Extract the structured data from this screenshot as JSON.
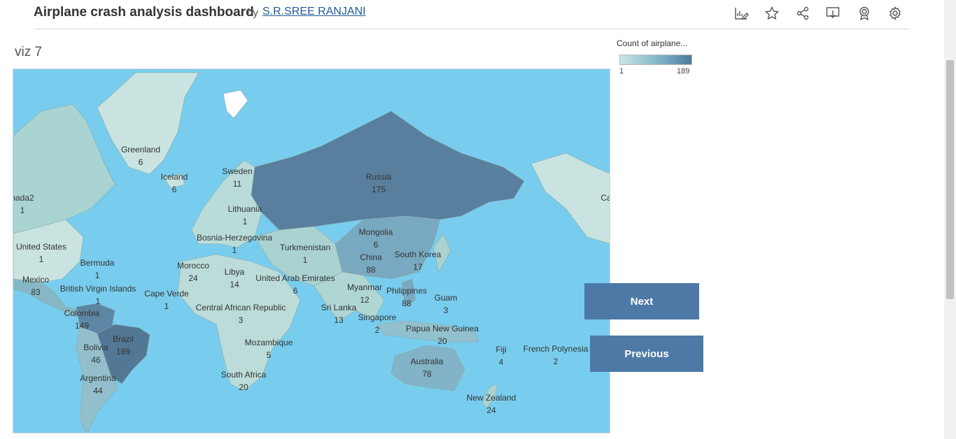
{
  "header": {
    "title": "Airplane crash analysis dashboard",
    "by": "by",
    "author": "S.R.SREE RANJANI",
    "icons": [
      "edit-chart-icon",
      "star-icon",
      "share-icon",
      "download-icon",
      "award-icon",
      "settings-icon"
    ]
  },
  "viz": {
    "title": "viz 7"
  },
  "legend": {
    "title": "Count of airplane...",
    "min": "1",
    "max": "189",
    "color_low": "#c7e6e4",
    "color_high": "#4e7a9a"
  },
  "map": {
    "ocean_color": "#78cdee",
    "labels": [
      {
        "name": "Greenland",
        "count": "6"
      },
      {
        "name": "Iceland",
        "count": "6"
      },
      {
        "name": "Sweden",
        "count": "11"
      },
      {
        "name": "Russia",
        "count": "175"
      },
      {
        "name": "nada2",
        "count": "1"
      },
      {
        "name": "Ca",
        "count": ""
      },
      {
        "name": "Lithuania",
        "count": "1"
      },
      {
        "name": "Bosnia-Herzegovina",
        "count": "1"
      },
      {
        "name": "Mongolia",
        "count": "6"
      },
      {
        "name": "Turkmenistan",
        "count": "1"
      },
      {
        "name": "United States",
        "count": "1"
      },
      {
        "name": "China",
        "count": "88"
      },
      {
        "name": "South Korea",
        "count": "17"
      },
      {
        "name": "Bermuda",
        "count": "1"
      },
      {
        "name": "Morocco",
        "count": "24"
      },
      {
        "name": "Libya",
        "count": "14"
      },
      {
        "name": "Mexico",
        "count": "83"
      },
      {
        "name": "British Virgin Islands",
        "count": "1"
      },
      {
        "name": "United Arab Emirates",
        "count": "6"
      },
      {
        "name": "Myanmar",
        "count": "12"
      },
      {
        "name": "Philippines",
        "count": "88"
      },
      {
        "name": "Cape Verde",
        "count": "1"
      },
      {
        "name": "Guam",
        "count": "3"
      },
      {
        "name": "Colombia",
        "count": "149"
      },
      {
        "name": "Central African Republic",
        "count": "3"
      },
      {
        "name": "Sri Lanka",
        "count": "13"
      },
      {
        "name": "Singapore",
        "count": "2"
      },
      {
        "name": "Papua New Guinea",
        "count": "20"
      },
      {
        "name": "Brazil",
        "count": "189"
      },
      {
        "name": "Bolivia",
        "count": "46"
      },
      {
        "name": "Mozambique",
        "count": "5"
      },
      {
        "name": "Fiji",
        "count": "4"
      },
      {
        "name": "French Polynesia",
        "count": "2"
      },
      {
        "name": "Australia",
        "count": "78"
      },
      {
        "name": "Argentina",
        "count": "44"
      },
      {
        "name": "South Africa",
        "count": "20"
      },
      {
        "name": "New Zealand",
        "count": "24"
      }
    ]
  },
  "buttons": {
    "next": "Next",
    "previous": "Previous"
  }
}
